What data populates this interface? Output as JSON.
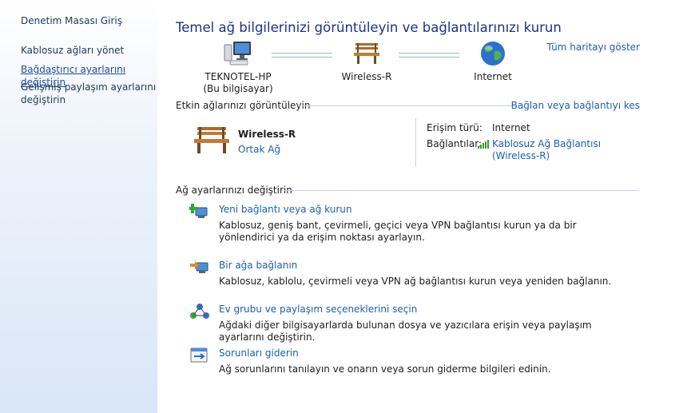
{
  "sidebar": {
    "home": "Denetim Masası Giriş",
    "items": [
      {
        "label": "Kablosuz ağları yönet"
      },
      {
        "label": "Bağdaştırıcı ayarlarını değiştirin"
      },
      {
        "label": "Gelişmiş paylaşım ayarlarını değiştirin"
      }
    ]
  },
  "main": {
    "title": "Temel ağ bilgilerinizi görüntüleyin ve bağlantılarınızı kurun",
    "full_map_link": "Tüm haritayı göster",
    "map": {
      "computer": {
        "name": "TEKNOTEL-HP",
        "sub": "(Bu bilgisayar)"
      },
      "network": {
        "name": "Wireless-R"
      },
      "internet": {
        "name": "Internet"
      }
    },
    "active_section": {
      "heading": "Etkin ağlarınızı görüntüleyin",
      "connect_link": "Bağlan veya bağlantıyı kes",
      "network_name": "Wireless-R",
      "network_type": "Ortak Ağ",
      "access_label": "Erişim türü:",
      "access_value": "Internet",
      "connections_label": "Bağlantılar:",
      "connection_line1": "Kablosuz Ağ Bağlantısı",
      "connection_line2": "(Wireless-R)"
    },
    "settings_section": {
      "heading": "Ağ ayarlarınızı değiştirin",
      "tasks": [
        {
          "title": "Yeni bağlantı veya ağ kurun",
          "desc": "Kablosuz, geniş bant, çevirmeli, geçici veya VPN bağlantısı kurun ya da bir yönlendirici ya da erişim noktası ayarlayın."
        },
        {
          "title": "Bir ağa bağlanın",
          "desc": "Kablosuz, kablolu, çevirmeli veya VPN ağ bağlantısı kurun veya yeniden bağlanın."
        },
        {
          "title": "Ev grubu ve paylaşım seçeneklerini seçin",
          "desc": "Ağdaki diğer bilgisayarlarda bulunan dosya ve yazıcılara erişin veya paylaşım ayarlarını değiştirin."
        },
        {
          "title": "Sorunları giderin",
          "desc": "Ağ sorunlarını tanılayın ve onarın veya sorun giderme bilgileri edinin."
        }
      ]
    }
  },
  "colors": {
    "link": "#1a5fb4",
    "title": "#1e3287",
    "sidebar_bottom": "#d9e6f7"
  },
  "icons": [
    "computer-icon",
    "bench-icon",
    "globe-icon",
    "signal-bars-icon",
    "new-connection-icon",
    "connect-network-icon",
    "homegroup-icon",
    "troubleshoot-icon"
  ]
}
